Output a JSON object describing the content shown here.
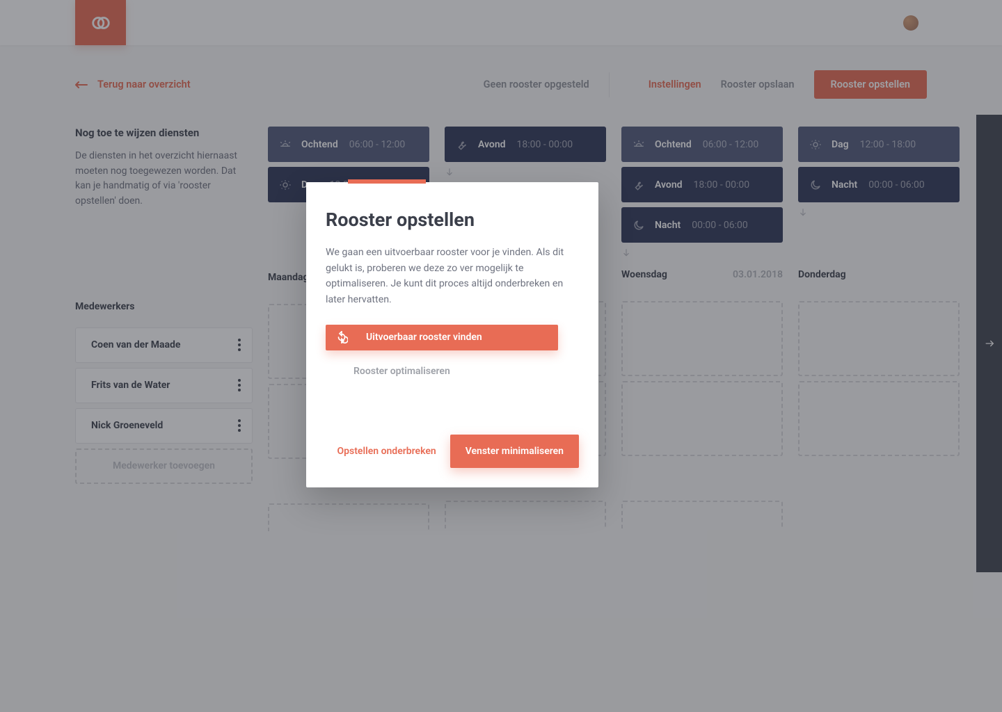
{
  "colors": {
    "accent": "#e86c55",
    "dark": "#2e3758",
    "darkLight": "#50597b"
  },
  "header": {},
  "toolbar": {
    "back": "Terug naar overzicht",
    "no_roster": "Geen rooster opgesteld",
    "settings": "Instellingen",
    "save": "Rooster opslaan",
    "create": "Rooster opstellen"
  },
  "sidebar": {
    "title": "Nog toe te wijzen diensten",
    "text": "De diensten in het overzicht hiernaast moeten nog toegewezen worden. Dat kan je handmatig of via 'rooster opstellen' doen.",
    "employees_label": "Medewerkers",
    "employees": [
      {
        "name": "Coen van der Maade"
      },
      {
        "name": "Frits van de Water"
      },
      {
        "name": "Nick Groeneveld"
      }
    ],
    "add_employee": "Medewerker toevoegen"
  },
  "shifts": {
    "ochtend": {
      "label": "Ochtend",
      "time": "06:00 - 12:00"
    },
    "dag": {
      "label": "Dag",
      "time": "12:00 - 18:00"
    },
    "avond": {
      "label": "Avond",
      "time": "18:00 - 00:00"
    },
    "nacht": {
      "label": "Nacht",
      "time": "00:00 - 06:00"
    }
  },
  "days": [
    {
      "name": "Maandag",
      "date": ""
    },
    {
      "name": "",
      "date": ""
    },
    {
      "name": "Woensdag",
      "date": "03.01.2018"
    },
    {
      "name": "Donderdag",
      "date": ""
    }
  ],
  "modal": {
    "title": "Rooster opstellen",
    "text": "We gaan een uitvoerbaar rooster voor je vinden. Als dit gelukt is, proberen we deze zo ver mogelijk te optimaliseren. Je kunt dit proces altijd onderbreken en later hervatten.",
    "action_primary": "Uitvoerbaar rooster vinden",
    "action_secondary": "Rooster optimaliseren",
    "cancel": "Opstellen onderbreken",
    "minimize": "Venster minimaliseren"
  }
}
